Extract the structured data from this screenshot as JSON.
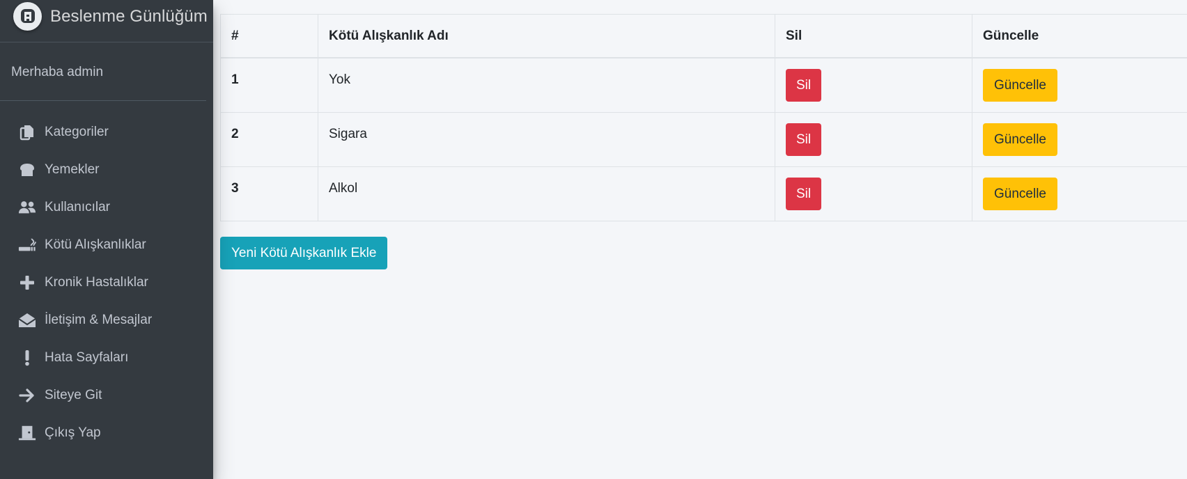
{
  "brand": {
    "title": "Beslenme Günlüğüm"
  },
  "user": {
    "greeting": "Merhaba admin"
  },
  "sidebar": {
    "items": [
      {
        "label": "Kategoriler",
        "icon": "copy-icon"
      },
      {
        "label": "Yemekler",
        "icon": "bread-icon"
      },
      {
        "label": "Kullanıcılar",
        "icon": "users-icon"
      },
      {
        "label": "Kötü Alışkanlıklar",
        "icon": "smoking-icon"
      },
      {
        "label": "Kronik Hastalıklar",
        "icon": "plus-icon"
      },
      {
        "label": "İletişim & Mesajlar",
        "icon": "envelope-open-icon"
      },
      {
        "label": "Hata Sayfaları",
        "icon": "exclamation-icon"
      },
      {
        "label": "Siteye Git",
        "icon": "arrow-right-icon"
      },
      {
        "label": "Çıkış Yap",
        "icon": "door-icon"
      }
    ]
  },
  "table": {
    "headers": [
      "#",
      "Kötü Alışkanlık Adı",
      "Sil",
      "Güncelle"
    ],
    "rows": [
      {
        "id": "1",
        "name": "Yok",
        "delete_label": "Sil",
        "update_label": "Güncelle"
      },
      {
        "id": "2",
        "name": "Sigara",
        "delete_label": "Sil",
        "update_label": "Güncelle"
      },
      {
        "id": "3",
        "name": "Alkol",
        "delete_label": "Sil",
        "update_label": "Güncelle"
      }
    ]
  },
  "actions": {
    "add_label": "Yeni Kötü Alışkanlık Ekle"
  },
  "colors": {
    "sidebar_bg": "#343a40",
    "danger": "#dc3545",
    "warning": "#ffc107",
    "info": "#17a2b8",
    "page_bg": "#f4f6f9"
  }
}
